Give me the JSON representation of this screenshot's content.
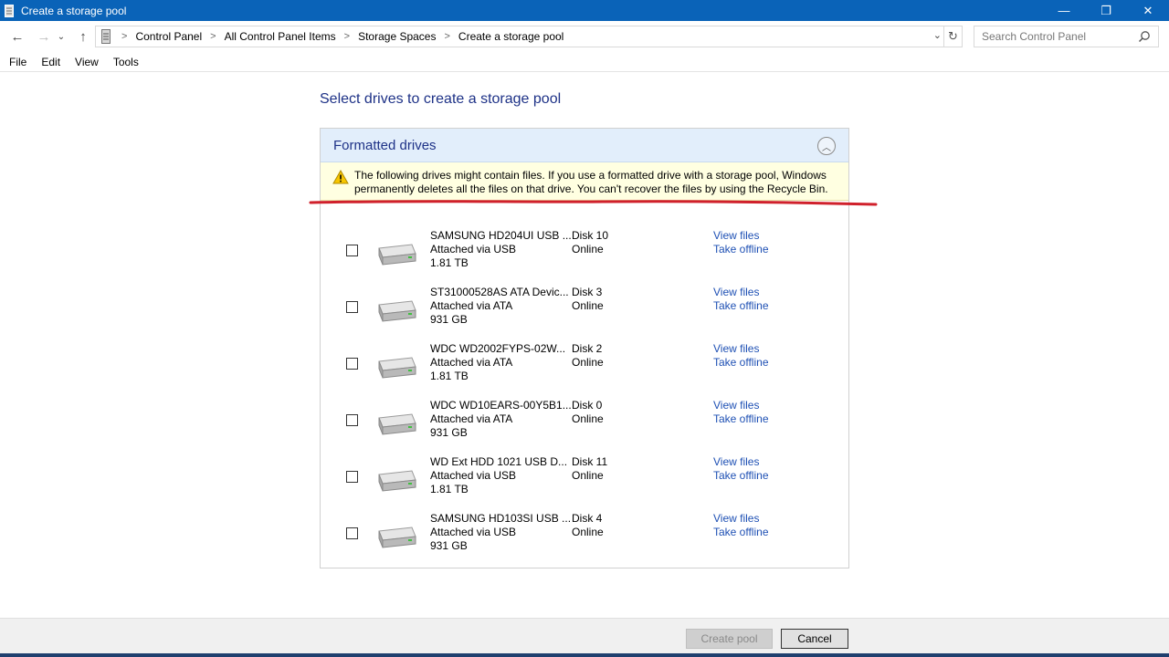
{
  "window": {
    "title": "Create a storage pool",
    "controls": {
      "minimize": "—",
      "maximize": "❐",
      "close": "✕"
    }
  },
  "address": {
    "breadcrumbs": [
      "Control Panel",
      "All Control Panel Items",
      "Storage Spaces",
      "Create a storage pool"
    ],
    "search_placeholder": "Search Control Panel"
  },
  "menu": [
    "File",
    "Edit",
    "View",
    "Tools"
  ],
  "content": {
    "heading": "Select drives to create a storage pool",
    "panel_title": "Formatted drives",
    "warning": "The following drives might contain files. If you use a formatted drive with a storage pool, Windows permanently deletes all the files on that drive. You can't recover the files by using the Recycle Bin.",
    "drives": [
      {
        "name": "SAMSUNG HD204UI USB ...",
        "attach": "Attached via USB",
        "size": "1.81 TB",
        "disk": "Disk 10",
        "status": "Online",
        "view": "View files",
        "offline": "Take offline"
      },
      {
        "name": "ST31000528AS ATA Devic...",
        "attach": "Attached via ATA",
        "size": "931 GB",
        "disk": "Disk 3",
        "status": "Online",
        "view": "View files",
        "offline": "Take offline"
      },
      {
        "name": "WDC WD2002FYPS-02W...",
        "attach": "Attached via ATA",
        "size": "1.81 TB",
        "disk": "Disk 2",
        "status": "Online",
        "view": "View files",
        "offline": "Take offline"
      },
      {
        "name": "WDC WD10EARS-00Y5B1...",
        "attach": "Attached via ATA",
        "size": "931 GB",
        "disk": "Disk 0",
        "status": "Online",
        "view": "View files",
        "offline": "Take offline"
      },
      {
        "name": "WD Ext HDD 1021 USB D...",
        "attach": "Attached via USB",
        "size": "1.81 TB",
        "disk": "Disk 11",
        "status": "Online",
        "view": "View files",
        "offline": "Take offline"
      },
      {
        "name": "SAMSUNG HD103SI USB ...",
        "attach": "Attached via USB",
        "size": "931 GB",
        "disk": "Disk 4",
        "status": "Online",
        "view": "View files",
        "offline": "Take offline"
      }
    ]
  },
  "footer": {
    "create_label": "Create pool",
    "cancel_label": "Cancel"
  },
  "colors": {
    "titlebar": "#0a63b8",
    "accent_text": "#1e3287",
    "link": "#1e50b4",
    "warning_bg": "#ffffe1",
    "annotation": "#d0202b"
  }
}
